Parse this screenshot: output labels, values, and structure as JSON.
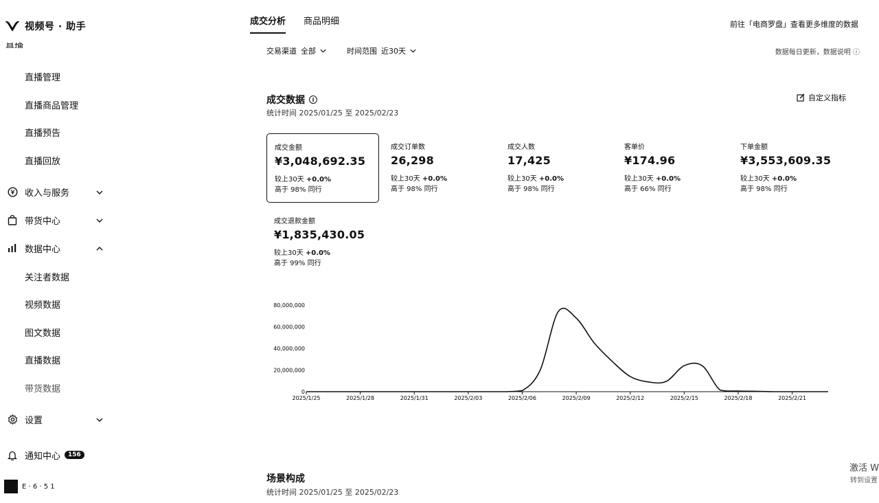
{
  "app": {
    "title": "视频号 · 助手"
  },
  "sidebar": {
    "partial_top": "直播",
    "items": [
      {
        "label": "直播管理"
      },
      {
        "label": "直播商品管理"
      },
      {
        "label": "直播预告"
      },
      {
        "label": "直播回放"
      },
      {
        "label": "收入与服务",
        "icon": "yuan-icon",
        "expand": "down"
      },
      {
        "label": "带货中心",
        "icon": "bag-icon",
        "expand": "down"
      },
      {
        "label": "数据中心",
        "icon": "bar-chart-icon",
        "expand": "up"
      },
      {
        "label": "关注者数据"
      },
      {
        "label": "视频数据"
      },
      {
        "label": "图文数据"
      },
      {
        "label": "直播数据"
      },
      {
        "label": "带货数据"
      },
      {
        "label": "设置",
        "icon": "gear-icon",
        "expand": "down"
      },
      {
        "label": "通知中心",
        "icon": "bell-icon",
        "badge": "156"
      }
    ]
  },
  "tabs": [
    {
      "label": "成交分析",
      "active": true
    },
    {
      "label": "商品明细",
      "active": false
    }
  ],
  "ext_link": "前往「电商罗盘」查看更多维度的数据",
  "filters": {
    "source_label": "交易渠道",
    "source_value": "全部",
    "time_label": "时间范围",
    "time_value": "近30天"
  },
  "update_note": "数据每日更新，数据说明",
  "deal": {
    "title": "成交数据",
    "range": "统计时间 2025/01/25 至 2025/02/23",
    "custom_metric": "自定义指标",
    "cards": [
      {
        "label": "成交金额",
        "value": "¥3,048,692.35",
        "compare_prefix": "较上30天",
        "compare_value": "+0.0%",
        "peer": "高于 98% 同行",
        "selected": true
      },
      {
        "label": "成交订单数",
        "value": "26,298",
        "compare_prefix": "较上30天",
        "compare_value": "+0.0%",
        "peer": "高于 98% 同行",
        "selected": false
      },
      {
        "label": "成交人数",
        "value": "17,425",
        "compare_prefix": "较上30天",
        "compare_value": "+0.0%",
        "peer": "高于 98% 同行",
        "selected": false
      },
      {
        "label": "客单价",
        "value": "¥174.96",
        "compare_prefix": "较上30天",
        "compare_value": "+0.0%",
        "peer": "高于 66% 同行",
        "selected": false
      },
      {
        "label": "下单金额",
        "value": "¥3,553,609.35",
        "compare_prefix": "较上30天",
        "compare_value": "+0.0%",
        "peer": "高于 98% 同行",
        "selected": false
      },
      {
        "label": "成交退款金额",
        "value": "¥1,835,430.05",
        "compare_prefix": "较上30天",
        "compare_value": "+0.0%",
        "peer": "高于 99% 同行",
        "selected": false
      }
    ]
  },
  "chart_data": {
    "type": "area",
    "x_ticks": [
      "2025/1/25",
      "2025/1/28",
      "2025/1/31",
      "2025/2/03",
      "2025/2/06",
      "2025/2/09",
      "2025/2/12",
      "2025/2/15",
      "2025/2/18",
      "2025/2/21"
    ],
    "y_ticks": [
      "0",
      "20,000,000",
      "40,000,000",
      "60,000,000",
      "80,000,000"
    ],
    "ylim": [
      0,
      80000000
    ],
    "x": [
      "2025/1/25",
      "2025/1/26",
      "2025/1/27",
      "2025/1/28",
      "2025/1/29",
      "2025/1/30",
      "2025/1/31",
      "2025/2/01",
      "2025/2/02",
      "2025/2/03",
      "2025/2/04",
      "2025/2/05",
      "2025/2/06",
      "2025/2/07",
      "2025/2/08",
      "2025/2/09",
      "2025/2/10",
      "2025/2/11",
      "2025/2/12",
      "2025/2/13",
      "2025/2/14",
      "2025/2/15",
      "2025/2/16",
      "2025/2/17",
      "2025/2/18",
      "2025/2/19",
      "2025/2/20",
      "2025/2/21",
      "2025/2/22",
      "2025/2/23"
    ],
    "values": [
      0,
      0,
      0,
      0,
      0,
      0,
      0,
      0,
      0,
      0,
      0,
      0,
      1000000,
      20000000,
      74000000,
      68000000,
      45000000,
      28000000,
      14000000,
      9000000,
      9500000,
      24000000,
      24000000,
      1500000,
      600000,
      400000,
      0,
      0,
      0,
      0
    ],
    "grid": false
  },
  "scene": {
    "title": "场景构成",
    "range": "统计时间 2025/01/25 至 2025/02/23"
  },
  "watermark": {
    "line1": "激活 W",
    "line2": "转到设置"
  },
  "bottom_user": {
    "name": "E · 6 · 5 1"
  }
}
